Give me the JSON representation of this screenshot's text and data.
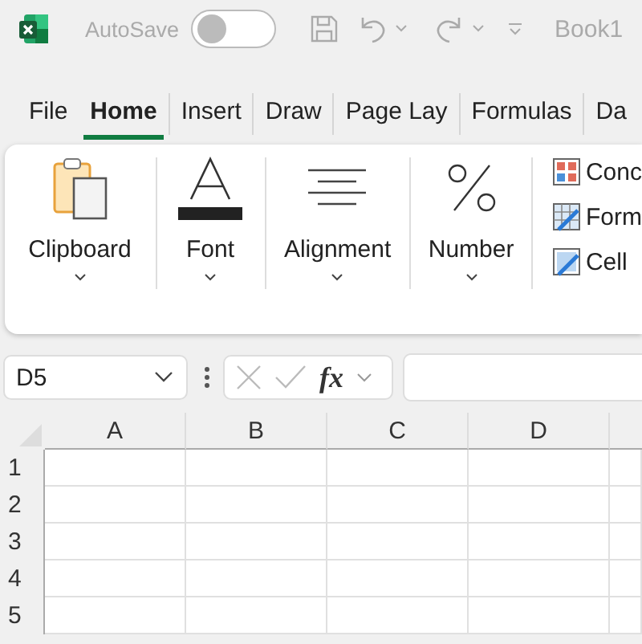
{
  "title_bar": {
    "autosave_label": "AutoSave",
    "autosave_on": false,
    "document_title": "Book1"
  },
  "tabs": [
    {
      "label": "File",
      "selected": false
    },
    {
      "label": "Home",
      "selected": true
    },
    {
      "label": "Insert",
      "selected": false
    },
    {
      "label": "Draw",
      "selected": false
    },
    {
      "label": "Page Lay",
      "selected": false
    },
    {
      "label": "Formulas",
      "selected": false
    },
    {
      "label": "Da",
      "selected": false
    }
  ],
  "ribbon": {
    "groups": [
      {
        "label": "Clipboard",
        "kind": "clipboard"
      },
      {
        "label": "Font",
        "kind": "font"
      },
      {
        "label": "Alignment",
        "kind": "alignment"
      },
      {
        "label": "Number",
        "kind": "number"
      }
    ],
    "style_commands": [
      {
        "label": "Conc",
        "kind": "conditional"
      },
      {
        "label": "Form",
        "kind": "table"
      },
      {
        "label": "Cell",
        "kind": "cell"
      }
    ]
  },
  "formula_bar": {
    "name_box": "D5",
    "function_label": "fx"
  },
  "sheet": {
    "columns": [
      "A",
      "B",
      "C",
      "D"
    ],
    "rows": [
      "1",
      "2",
      "3",
      "4",
      "5"
    ]
  }
}
